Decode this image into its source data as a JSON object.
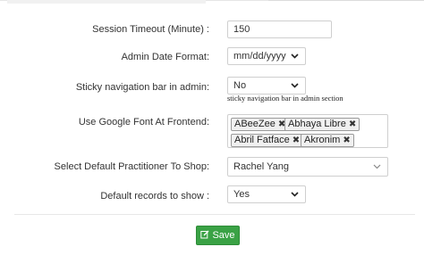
{
  "form": {
    "session_timeout": {
      "label": "Session Timeout (Minute) :",
      "value": "150"
    },
    "admin_date_format": {
      "label": "Admin Date Format:",
      "value": "mm/dd/yyyy"
    },
    "sticky_nav": {
      "label": "Sticky navigation bar in admin:",
      "value": "No",
      "hint": "sticky navigation bar in admin section"
    },
    "google_font": {
      "label": "Use Google Font At Frontend:",
      "tags": [
        "ABeeZee",
        "Abhaya Libre",
        "Abril Fatface",
        "Akronim"
      ]
    },
    "default_practitioner": {
      "label": "Select Default Practitioner To Shop:",
      "value": "Rachel Yang"
    },
    "default_records": {
      "label": "Default records to show :",
      "value": "Yes"
    }
  },
  "actions": {
    "save_label": "Save"
  },
  "colors": {
    "save_green": "#3aa245",
    "border": "#cfcfcf"
  },
  "icons": {
    "save": "edit-icon",
    "dropdown": "chevron-down-icon",
    "remove_tag": "close-icon"
  }
}
